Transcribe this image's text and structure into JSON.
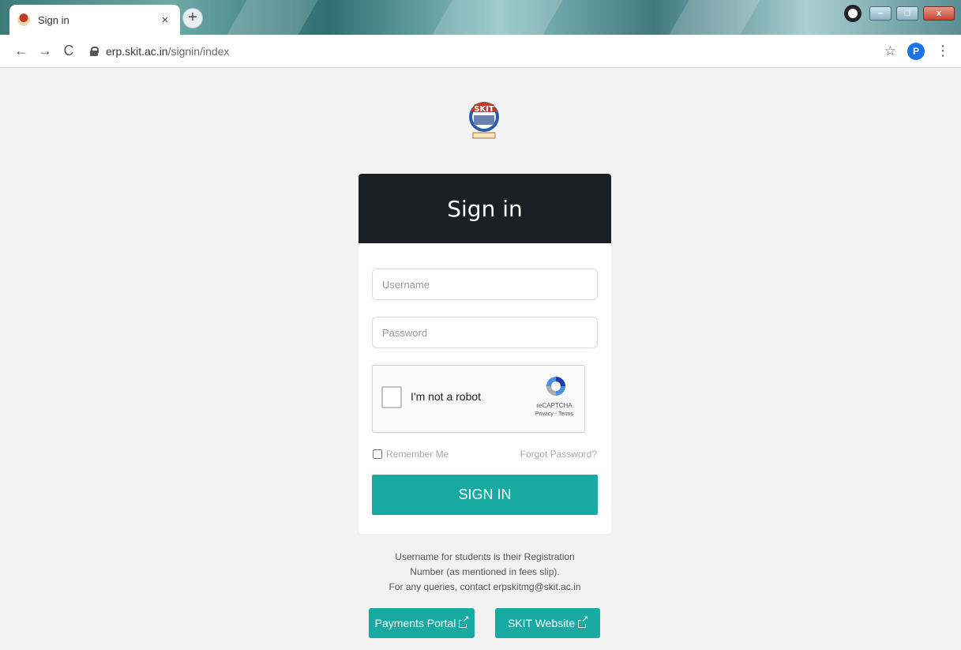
{
  "browser": {
    "tab_title": "Sign in",
    "tab_close": "×",
    "new_tab": "+",
    "url_host": "erp.skit.ac.in",
    "url_path": "/signin/index",
    "profile_initial": "P",
    "icons": {
      "back": "back-arrow-icon",
      "forward": "forward-arrow-icon",
      "reload": "reload-icon",
      "lock": "lock-icon",
      "star": "star-icon",
      "menu": "kebab-menu-icon"
    }
  },
  "page": {
    "logo_text": "SKIT",
    "signin": {
      "header_title": "Sign in",
      "username_placeholder": "Username",
      "password_placeholder": "Password",
      "captcha_label": "I'm not a robot",
      "captcha_brand": "reCAPTCHA",
      "captcha_terms": "Privacy - Terms",
      "remember_label": "Remember Me",
      "forgot_label": "Forgot Password?",
      "submit_label": "SIGN IN"
    },
    "help": {
      "line1": "Username for students is their Registration Number (as mentioned in fees slip).",
      "line2": "For any queries, contact erpskitmg@skit.ac.in"
    },
    "links": {
      "payments_label": "Payments Portal",
      "website_label": "SKIT Website"
    },
    "colors": {
      "accent": "#17a9a2",
      "header_bg": "#1b1f23",
      "page_bg": "#f2f2f2"
    }
  }
}
